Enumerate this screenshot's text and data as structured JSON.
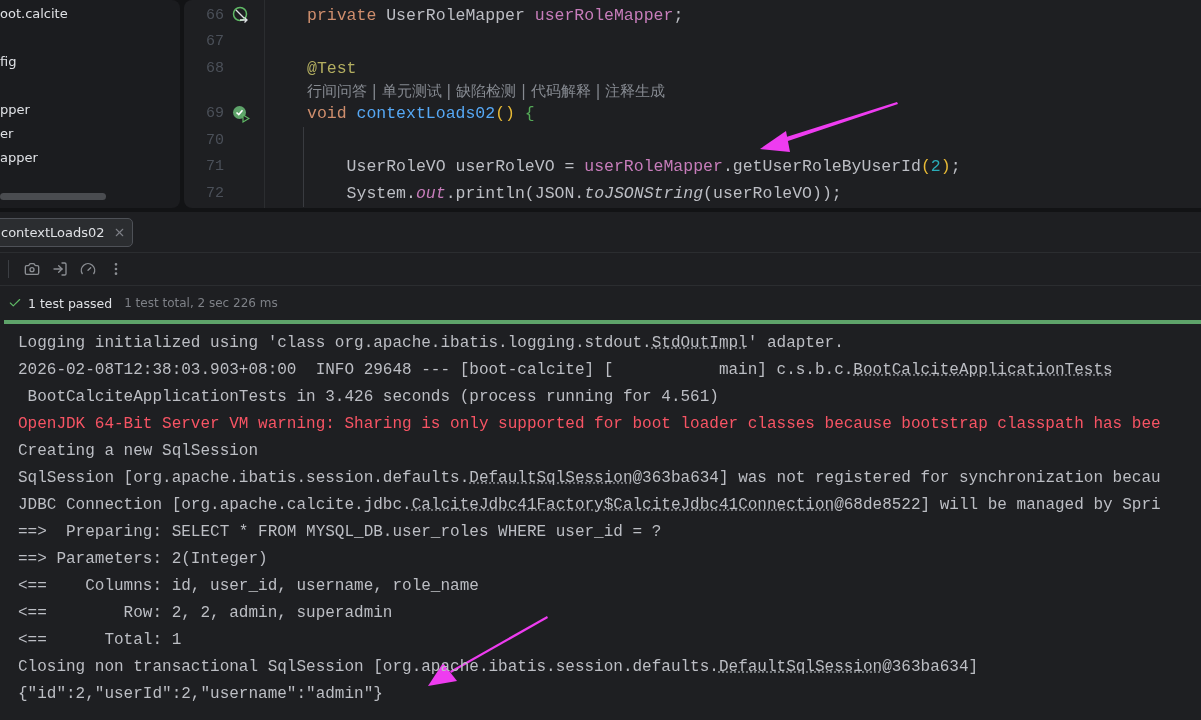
{
  "project_tree": {
    "items": [
      {
        "label": "oot.calcite"
      },
      {
        "label": "fig"
      },
      {
        "label": "pper"
      },
      {
        "label": "er"
      },
      {
        "label": "apper"
      }
    ]
  },
  "editor": {
    "lines": [
      {
        "number": "66",
        "gutter": {
          "kind": "bean"
        },
        "code": [
          {
            "text": "private ",
            "kind": "keyword"
          },
          {
            "text": "UserRoleMapper ",
            "kind": "plain"
          },
          {
            "text": "userRoleMapper",
            "kind": "field"
          },
          {
            "text": ";",
            "kind": "plain"
          }
        ]
      },
      {
        "number": "67"
      },
      {
        "number": "68",
        "code": [
          {
            "text": "@Test",
            "kind": "annotation"
          }
        ]
      },
      {
        "kind": "hint",
        "text": "行间问答 | 单元测试 | 缺陷检测 | 代码解释 | 注释生成"
      },
      {
        "number": "69",
        "gutter": {
          "kind": "test-passed"
        },
        "code": [
          {
            "text": "void ",
            "kind": "keyword"
          },
          {
            "text": "contextLoads02",
            "kind": "method"
          },
          {
            "text": "() ",
            "kind": "paren"
          },
          {
            "text": "{",
            "kind": "brace"
          }
        ]
      },
      {
        "number": "70",
        "guide": true
      },
      {
        "number": "71",
        "guide": true,
        "code": [
          {
            "text": "    UserRoleVO userRoleVO = ",
            "kind": "plain"
          },
          {
            "text": "userRoleMapper",
            "kind": "field"
          },
          {
            "text": ".getUserRoleByUserId",
            "kind": "plain"
          },
          {
            "text": "(",
            "kind": "paren"
          },
          {
            "text": "2",
            "kind": "number"
          },
          {
            "text": ")",
            "kind": "paren"
          },
          {
            "text": ";",
            "kind": "plain"
          }
        ]
      },
      {
        "number": "72",
        "guide": true,
        "code": [
          {
            "text": "    System.",
            "kind": "plain"
          },
          {
            "text": "out",
            "kind": "static"
          },
          {
            "text": ".println(JSON.",
            "kind": "plain"
          },
          {
            "text": "toJSONString",
            "kind": "italic"
          },
          {
            "text": "(",
            "kind": "plain"
          },
          {
            "text": "userRoleVO",
            "kind": "plain"
          },
          {
            "text": "))",
            "kind": "plain"
          },
          {
            "text": ";",
            "kind": "plain"
          }
        ]
      }
    ]
  },
  "run_tabs": [
    {
      "label": "contextLoads02",
      "selected": true
    }
  ],
  "status": {
    "passed": "1 test passed",
    "summary": "1 test total, 2 sec 226 ms"
  },
  "progress": {
    "level": 1
  },
  "console": [
    {
      "kind": "info",
      "parts": [
        {
          "text": "Logging initialized using 'class org.apache.ibatis.logging.stdout."
        },
        {
          "text": "StdOutImpl",
          "link": true
        },
        {
          "text": "' adapter."
        }
      ]
    },
    {
      "kind": "info",
      "parts": [
        {
          "text": "2026-02-08T12:38:03.903+08:00  INFO 29648 --- [boot-calcite] [           main] c.s.b.c."
        },
        {
          "text": "BootCalciteApplicationTests",
          "link": true
        }
      ]
    },
    {
      "kind": "info",
      "parts": [
        {
          "text": " BootCalciteApplicationTests in 3.426 seconds (process running for 4.561)"
        }
      ]
    },
    {
      "kind": "error",
      "parts": [
        {
          "text": "OpenJDK 64-Bit Server VM warning: Sharing is only supported for boot loader classes because bootstrap classpath has bee"
        }
      ]
    },
    {
      "kind": "info",
      "parts": [
        {
          "text": "Creating a new SqlSession"
        }
      ]
    },
    {
      "kind": "info",
      "parts": [
        {
          "text": "SqlSession [org.apache.ibatis.session.defaults."
        },
        {
          "text": "DefaultSqlSession",
          "link": true
        },
        {
          "text": "@363ba634] was not registered for synchronization becau"
        }
      ]
    },
    {
      "kind": "info",
      "parts": [
        {
          "text": "JDBC Connection [org.apache.calcite.jdbc."
        },
        {
          "text": "CalciteJdbc41Factory$CalciteJdbc41Connection",
          "link": true
        },
        {
          "text": "@68de8522] will be managed by Spri"
        }
      ]
    },
    {
      "kind": "info",
      "parts": [
        {
          "text": "==>  Preparing: SELECT * FROM MYSQL_DB.user_roles WHERE user_id = ?"
        }
      ]
    },
    {
      "kind": "info",
      "parts": [
        {
          "text": "==> Parameters: 2(Integer)"
        }
      ]
    },
    {
      "kind": "info",
      "parts": [
        {
          "text": "<==    Columns: id, user_id, username, role_name"
        }
      ]
    },
    {
      "kind": "info",
      "parts": [
        {
          "text": "<==        Row: 2, 2, admin, superadmin"
        }
      ]
    },
    {
      "kind": "info",
      "parts": [
        {
          "text": "<==      Total: 1"
        }
      ]
    },
    {
      "kind": "info",
      "parts": [
        {
          "text": "Closing non transactional SqlSession [org.apache.ibatis.session.defaults."
        },
        {
          "text": "DefaultSqlSession",
          "link": true
        },
        {
          "text": "@363ba634]"
        }
      ]
    },
    {
      "kind": "info",
      "parts": [
        {
          "text": "{\"id\":2,\"userId\":2,\"username\":\"admin\"}"
        }
      ]
    }
  ]
}
